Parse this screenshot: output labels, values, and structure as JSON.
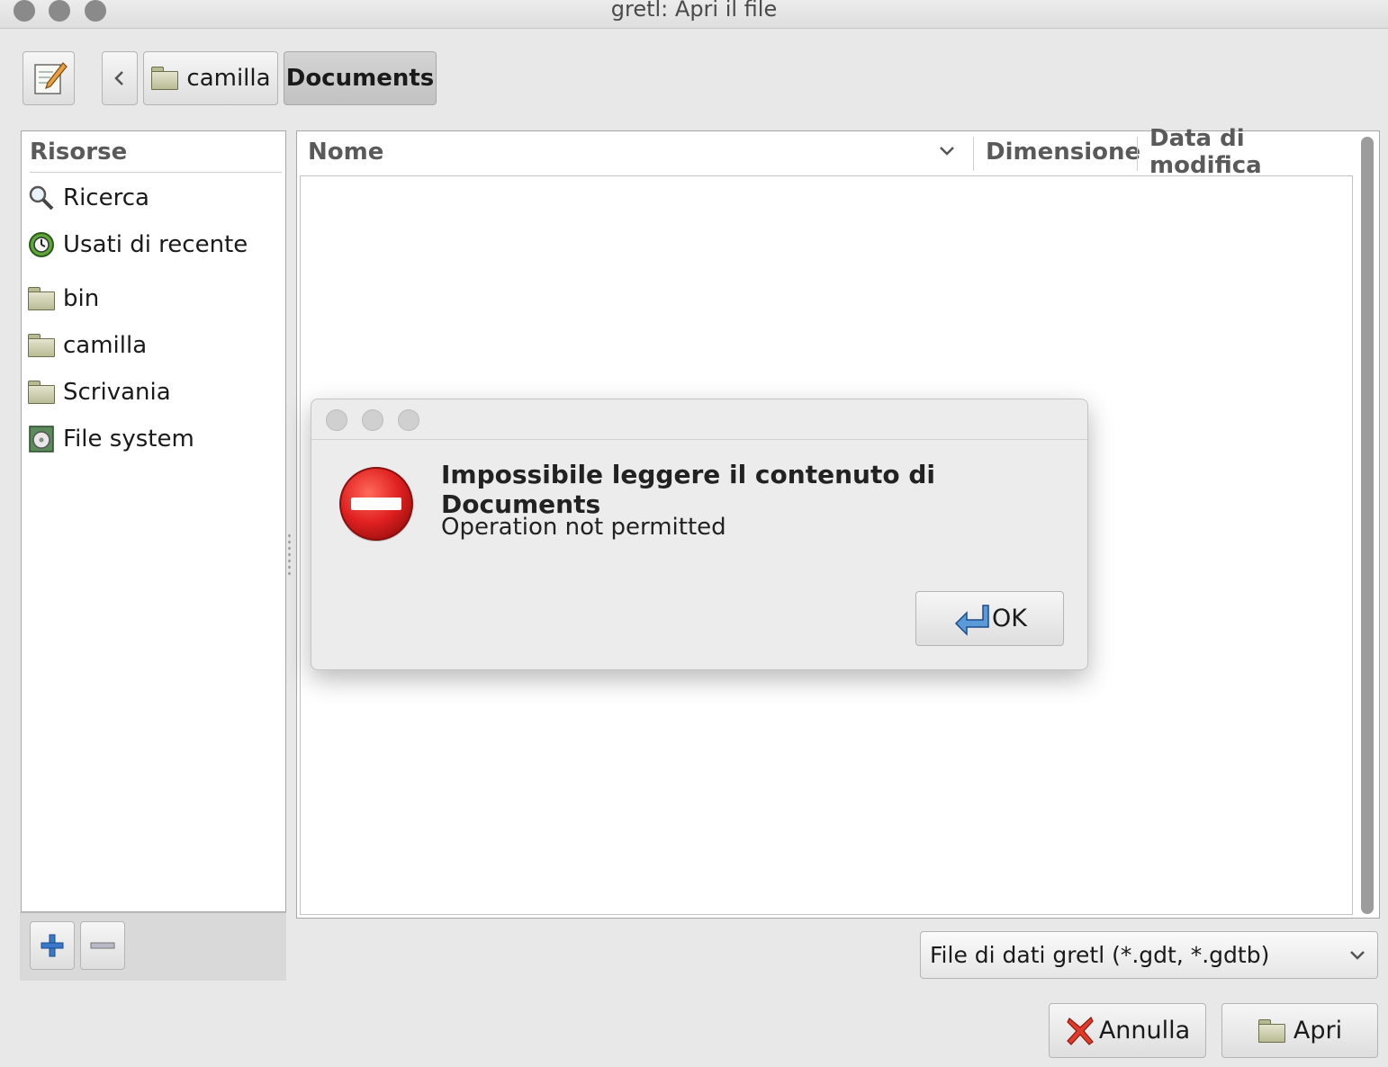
{
  "window": {
    "title": "gretl: Apri il file",
    "controls": [
      "close",
      "minimize",
      "zoom"
    ]
  },
  "toolbar": {
    "edit_location_icon": "pencil-notepad-icon",
    "back_icon": "chevron-left-icon",
    "path": [
      {
        "label": "camilla",
        "icon": "folder-icon",
        "active": false
      },
      {
        "label": "Documents",
        "active": true
      }
    ]
  },
  "places": {
    "header": "Risorse",
    "items": [
      {
        "label": "Ricerca",
        "icon": "search-icon"
      },
      {
        "label": "Usati di recente",
        "icon": "recent-icon"
      },
      {
        "label": "bin",
        "icon": "folder-icon"
      },
      {
        "label": "camilla",
        "icon": "folder-icon"
      },
      {
        "label": "Scrivania",
        "icon": "folder-icon"
      },
      {
        "label": "File system",
        "icon": "drive-icon"
      }
    ],
    "add_icon": "plus-icon",
    "remove_icon": "minus-icon"
  },
  "files": {
    "columns": [
      "Nome",
      "Dimensione",
      "Data di modifica"
    ],
    "sort_icon": "chevron-down-icon",
    "rows": []
  },
  "filter": {
    "selected": "File di dati gretl (*.gdt, *.gdtb)"
  },
  "buttons": {
    "cancel": "Annulla",
    "open": "Apri"
  },
  "dialog": {
    "icon": "error-icon",
    "title": "Impossibile leggere il contenuto di Documents",
    "message": "Operation not permitted",
    "ok_label": "OK"
  },
  "colors": {
    "error_red": "#e02020",
    "window_bg": "#e8e8e8"
  }
}
